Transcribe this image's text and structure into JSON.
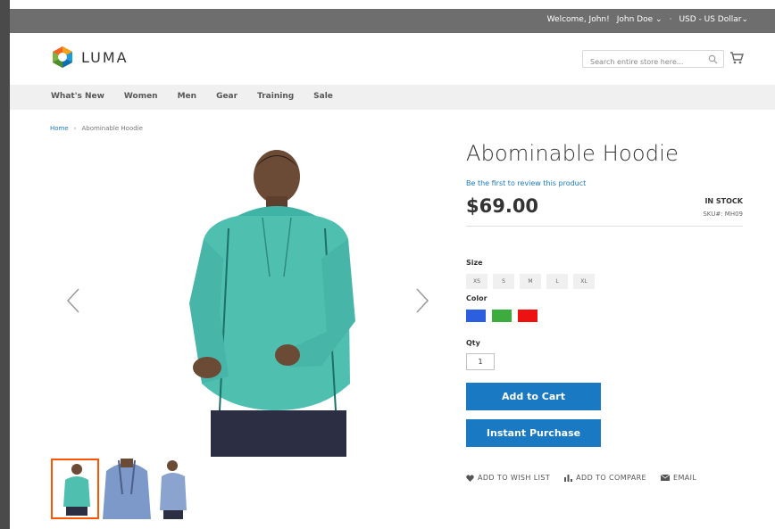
{
  "topbar": {
    "welcome": "Welcome, John!",
    "account": "John Doe",
    "currency": "USD - US Dollar"
  },
  "header": {
    "logo_text": "LUMA",
    "search_placeholder": "Search entire store here...",
    "icons": [
      "search-icon",
      "cart-icon",
      "chevron-down-icon"
    ]
  },
  "nav": {
    "items": [
      "What's New",
      "Women",
      "Men",
      "Gear",
      "Training",
      "Sale"
    ]
  },
  "breadcrumb": {
    "home": "Home",
    "divider": "›",
    "current": "Abominable Hoodie"
  },
  "product": {
    "name": "Abominable Hoodie",
    "review_link": "Be the first to review this product",
    "price": "$69.00",
    "stock": "IN STOCK",
    "sku_label": "SKU#:",
    "sku": "MH09",
    "size_label": "Size",
    "sizes": [
      "XS",
      "S",
      "M",
      "L",
      "XL"
    ],
    "color_label": "Color",
    "colors": [
      "#2b5fe0",
      "#3cac3c",
      "#ee1111"
    ],
    "qty_label": "Qty",
    "qty": "1",
    "add_to_cart": "Add to Cart",
    "instant_purchase": "Instant Purchase",
    "wishlist": "ADD TO WISH LIST",
    "compare": "ADD TO COMPARE",
    "email": "EMAIL"
  },
  "colors": {
    "accent": "#1979c3",
    "topbar": "#6e6e6e",
    "active_thumb": "#ff5501",
    "hoodie": "#4fbfb0"
  }
}
